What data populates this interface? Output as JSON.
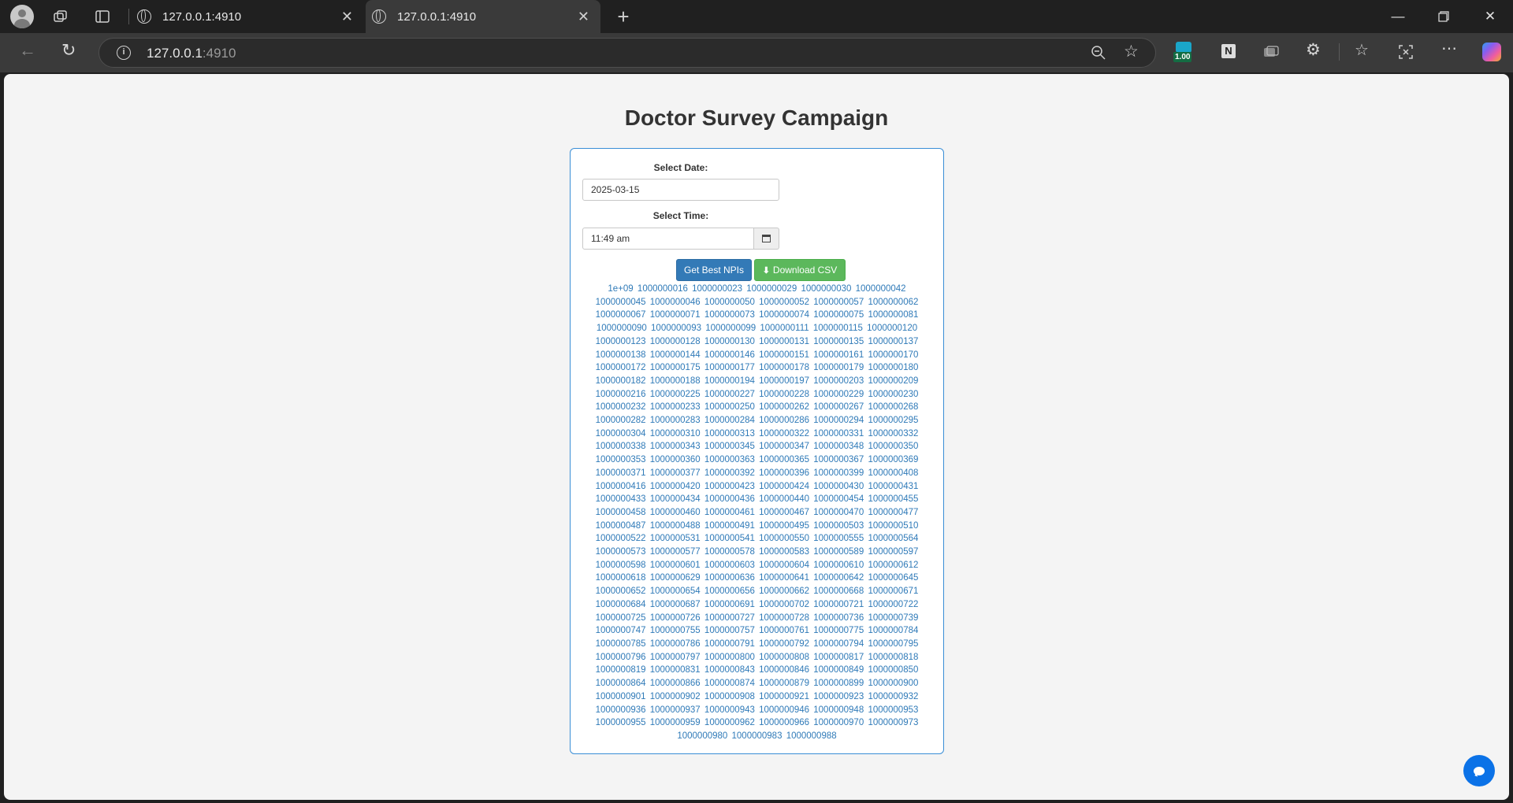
{
  "browser": {
    "tabs": [
      {
        "title": "127.0.0.1:4910",
        "active": false
      },
      {
        "title": "127.0.0.1:4910",
        "active": true
      }
    ],
    "address": {
      "host": "127.0.0.1",
      "port": ":4910"
    },
    "extension_badge": "1.00"
  },
  "page": {
    "title": "Doctor Survey Campaign",
    "date_label": "Select Date:",
    "date_value": "2025-03-15",
    "time_label": "Select Time:",
    "time_value": "11:49 am",
    "get_button": "Get Best NPIs",
    "download_button": "Download CSV",
    "npis": [
      "1e+09",
      "1000000016",
      "1000000023",
      "1000000029",
      "1000000030",
      "1000000042",
      "1000000045",
      "1000000046",
      "1000000050",
      "1000000052",
      "1000000057",
      "1000000062",
      "1000000067",
      "1000000071",
      "1000000073",
      "1000000074",
      "1000000075",
      "1000000081",
      "1000000090",
      "1000000093",
      "1000000099",
      "1000000111",
      "1000000115",
      "1000000120",
      "1000000123",
      "1000000128",
      "1000000130",
      "1000000131",
      "1000000135",
      "1000000137",
      "1000000138",
      "1000000144",
      "1000000146",
      "1000000151",
      "1000000161",
      "1000000170",
      "1000000172",
      "1000000175",
      "1000000177",
      "1000000178",
      "1000000179",
      "1000000180",
      "1000000182",
      "1000000188",
      "1000000194",
      "1000000197",
      "1000000203",
      "1000000209",
      "1000000216",
      "1000000225",
      "1000000227",
      "1000000228",
      "1000000229",
      "1000000230",
      "1000000232",
      "1000000233",
      "1000000250",
      "1000000262",
      "1000000267",
      "1000000268",
      "1000000282",
      "1000000283",
      "1000000284",
      "1000000286",
      "1000000294",
      "1000000295",
      "1000000304",
      "1000000310",
      "1000000313",
      "1000000322",
      "1000000331",
      "1000000332",
      "1000000338",
      "1000000343",
      "1000000345",
      "1000000347",
      "1000000348",
      "1000000350",
      "1000000353",
      "1000000360",
      "1000000363",
      "1000000365",
      "1000000367",
      "1000000369",
      "1000000371",
      "1000000377",
      "1000000392",
      "1000000396",
      "1000000399",
      "1000000408",
      "1000000416",
      "1000000420",
      "1000000423",
      "1000000424",
      "1000000430",
      "1000000431",
      "1000000433",
      "1000000434",
      "1000000436",
      "1000000440",
      "1000000454",
      "1000000455",
      "1000000458",
      "1000000460",
      "1000000461",
      "1000000467",
      "1000000470",
      "1000000477",
      "1000000487",
      "1000000488",
      "1000000491",
      "1000000495",
      "1000000503",
      "1000000510",
      "1000000522",
      "1000000531",
      "1000000541",
      "1000000550",
      "1000000555",
      "1000000564",
      "1000000573",
      "1000000577",
      "1000000578",
      "1000000583",
      "1000000589",
      "1000000597",
      "1000000598",
      "1000000601",
      "1000000603",
      "1000000604",
      "1000000610",
      "1000000612",
      "1000000618",
      "1000000629",
      "1000000636",
      "1000000641",
      "1000000642",
      "1000000645",
      "1000000652",
      "1000000654",
      "1000000656",
      "1000000662",
      "1000000668",
      "1000000671",
      "1000000684",
      "1000000687",
      "1000000691",
      "1000000702",
      "1000000721",
      "1000000722",
      "1000000725",
      "1000000726",
      "1000000727",
      "1000000728",
      "1000000736",
      "1000000739",
      "1000000747",
      "1000000755",
      "1000000757",
      "1000000761",
      "1000000775",
      "1000000784",
      "1000000785",
      "1000000786",
      "1000000791",
      "1000000792",
      "1000000794",
      "1000000795",
      "1000000796",
      "1000000797",
      "1000000800",
      "1000000808",
      "1000000817",
      "1000000818",
      "1000000819",
      "1000000831",
      "1000000843",
      "1000000846",
      "1000000849",
      "1000000850",
      "1000000864",
      "1000000866",
      "1000000874",
      "1000000879",
      "1000000899",
      "1000000900",
      "1000000901",
      "1000000902",
      "1000000908",
      "1000000921",
      "1000000923",
      "1000000932",
      "1000000936",
      "1000000937",
      "1000000943",
      "1000000946",
      "1000000948",
      "1000000953",
      "1000000955",
      "1000000959",
      "1000000962",
      "1000000966",
      "1000000970",
      "1000000973",
      "1000000980",
      "1000000983",
      "1000000988"
    ]
  }
}
